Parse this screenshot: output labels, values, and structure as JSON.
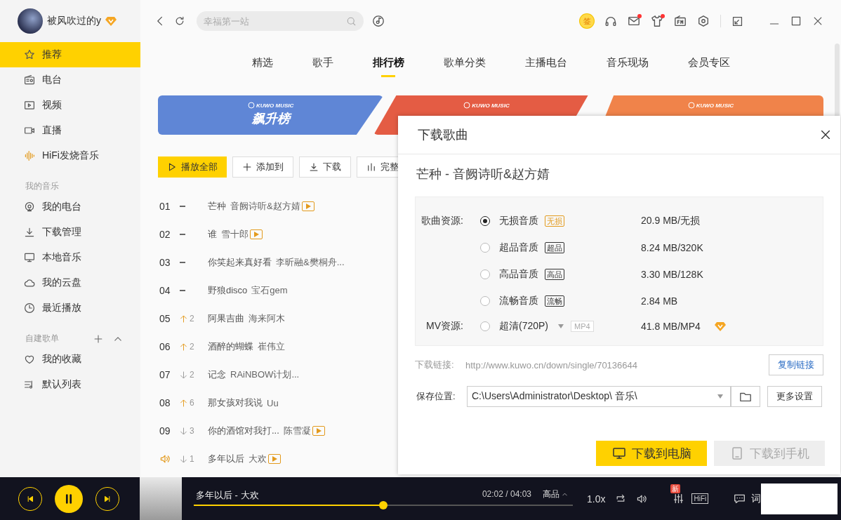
{
  "user": {
    "name": "被风吹过的y"
  },
  "sidebar": {
    "items": [
      {
        "label": "推荐",
        "selected": true
      },
      {
        "label": "电台",
        "selected": false
      },
      {
        "label": "视频",
        "selected": false
      },
      {
        "label": "直播",
        "selected": false
      },
      {
        "label": "HiFi发烧音乐",
        "selected": false
      }
    ],
    "sections": [
      {
        "title": "我的音乐",
        "items": [
          {
            "label": "我的电台",
            "selected": false
          },
          {
            "label": "下载管理",
            "selected": false
          },
          {
            "label": "本地音乐",
            "selected": false
          },
          {
            "label": "我的云盘",
            "selected": false
          },
          {
            "label": "最近播放",
            "selected": false
          }
        ]
      },
      {
        "title": "自建歌单",
        "expanded": true,
        "items": [
          {
            "label": "我的收藏",
            "selected": false
          },
          {
            "label": "默认列表",
            "selected": false
          }
        ]
      }
    ]
  },
  "search": {
    "placeholder": "幸福第一站"
  },
  "sign_in": "签",
  "tabs": [
    {
      "label": "精选",
      "selected": false
    },
    {
      "label": "歌手",
      "selected": false
    },
    {
      "label": "排行榜",
      "selected": true
    },
    {
      "label": "歌单分类",
      "selected": false
    },
    {
      "label": "主播电台",
      "selected": false
    },
    {
      "label": "音乐现场",
      "selected": false
    },
    {
      "label": "会员专区",
      "selected": false
    }
  ],
  "banners": [
    {
      "brand": "KUWO MUSIC",
      "title": "飙升榜",
      "color": "#5f86d6"
    },
    {
      "brand": "KUWO MUSIC",
      "color": "#e45c44"
    },
    {
      "brand": "KUWO MUSIC",
      "color": "#f0834a"
    }
  ],
  "actions": [
    {
      "label": "播放全部",
      "kind": "primary"
    },
    {
      "label": "添加到",
      "kind": "normal"
    },
    {
      "label": "下载",
      "kind": "normal"
    },
    {
      "label": "完整",
      "kind": "normal"
    }
  ],
  "songs": [
    {
      "rank": "01",
      "kind": "same",
      "title": "芒种",
      "artist": "音阙诗听&赵方婧",
      "mv": true,
      "playing": false
    },
    {
      "rank": "02",
      "kind": "same",
      "title": "谁",
      "artist": "雪十郎",
      "mv": true,
      "playing": false
    },
    {
      "rank": "03",
      "kind": "same",
      "title": "你笑起来真好看",
      "artist": "李昕融&樊桐舟...",
      "mv": false,
      "playing": false
    },
    {
      "rank": "04",
      "kind": "same",
      "title": "野狼disco",
      "artist": "宝石gem",
      "mv": false,
      "playing": false
    },
    {
      "rank": "05",
      "kind": "up",
      "change": "2",
      "title": "阿果吉曲",
      "artist": "海来阿木",
      "mv": false,
      "playing": false
    },
    {
      "rank": "06",
      "kind": "up",
      "change": "2",
      "title": "酒醉的蝴蝶",
      "artist": "崔伟立",
      "mv": false,
      "playing": false
    },
    {
      "rank": "07",
      "kind": "down",
      "change": "2",
      "title": "记念",
      "artist": "RAiNBOW计划...",
      "mv": false,
      "playing": false
    },
    {
      "rank": "08",
      "kind": "up",
      "change": "6",
      "title": "那女孩对我说",
      "artist": "Uu",
      "mv": false,
      "playing": false
    },
    {
      "rank": "09",
      "kind": "down",
      "change": "3",
      "title": "你的酒馆对我打...",
      "artist": "陈雪凝",
      "mv": true,
      "playing": false
    },
    {
      "kind": "down",
      "change": "1",
      "title": "多年以后",
      "artist": "大欢",
      "mv": true,
      "playing": true
    }
  ],
  "dialog": {
    "title": "下载歌曲",
    "song": "芒种 - 音阙诗听&赵方婧",
    "source_label": "歌曲资源:",
    "qualities": [
      {
        "name": "无损音质",
        "tag": "无损",
        "color": "#e39a1d",
        "size": "20.9 MB/无损",
        "selected": true
      },
      {
        "name": "超品音质",
        "tag": "超品",
        "color": "#333333",
        "size": "8.24 MB/320K",
        "selected": false
      },
      {
        "name": "高品音质",
        "tag": "高品",
        "color": "#333333",
        "size": "3.30 MB/128K",
        "selected": false
      },
      {
        "name": "流畅音质",
        "tag": "流畅",
        "color": "#333333",
        "size": "2.84 MB",
        "selected": false
      }
    ],
    "mv_label": "MV资源:",
    "mv": {
      "name": "超清(720P)",
      "format": "MP4",
      "size": "41.8 MB/MP4",
      "selected": false
    },
    "link_label": "下载链接:",
    "link": "http://www.kuwo.cn/down/single/70136644",
    "copy_button": "复制链接",
    "save_label": "保存位置:",
    "save_path": "C:\\Users\\Administrator\\Desktop\\ 音乐\\",
    "more_settings": "更多设置",
    "download_pc": "下载到电脑",
    "download_phone": {
      "label": "下载到手机",
      "disabled": true
    }
  },
  "player": {
    "playing": true,
    "title": "多年以后 - 大欢",
    "time": "02:02 / 04:03",
    "quality": "高品",
    "level": 0.5,
    "speed": "1.0x",
    "eq_badge": "新",
    "hifi": "HiFi",
    "lyrics": "词"
  }
}
